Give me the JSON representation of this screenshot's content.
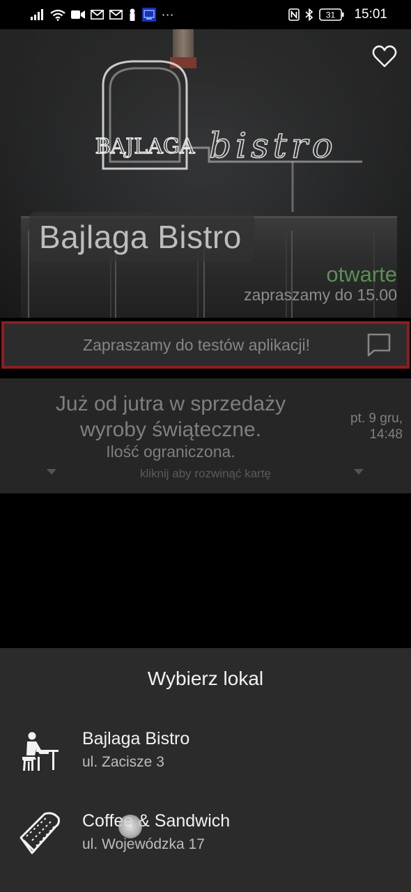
{
  "status_bar": {
    "time": "15:01",
    "battery": "31",
    "overflow": "···",
    "icons": [
      "signal-icon",
      "wifi-icon",
      "video-icon",
      "gmail-icon",
      "gmail-icon",
      "notification-icon",
      "app-icon",
      "nfc-icon",
      "bluetooth-icon",
      "battery-icon"
    ]
  },
  "hero": {
    "title": "Bajlaga Bistro",
    "status": "otwarte",
    "hours": "zapraszamy do 15.00",
    "status_color": "#5c8f57",
    "favorite_icon": "heart-outline-icon",
    "sign_text": "BAJLAGA",
    "sign_script": "bistro"
  },
  "message": {
    "text": "Zapraszamy do testów aplikacji!",
    "icon": "chat-icon",
    "border_color": "#8a1f1f"
  },
  "news": {
    "title": "Już od jutra w sprzedaży wyroby świąteczne.",
    "subtitle": "Ilość ograniczona.",
    "date": "pt. 9 gru,",
    "time": "14:48",
    "expand_label": "kliknij aby rozwinąć kartę"
  },
  "sheet": {
    "title": "Wybierz lokal",
    "venues": [
      {
        "name": "Bajlaga Bistro",
        "address": "ul. Zacisze 3",
        "icon": "dining-person-icon"
      },
      {
        "name": "Coffee & Sandwich",
        "address": "ul. Wojewódzka 17",
        "icon": "sandwich-icon"
      }
    ]
  }
}
